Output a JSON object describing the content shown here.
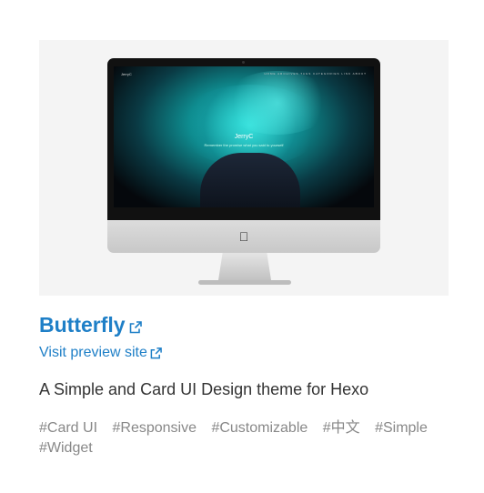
{
  "card": {
    "title": "Butterfly",
    "preview_link": "Visit preview site",
    "description": "A Simple and Card UI Design theme for Hexo",
    "tags": [
      "#Card UI",
      "#Responsive",
      "#Customizable",
      "#中文",
      "#Simple",
      "#Widget"
    ],
    "screenshot": {
      "site_name": "JerryC",
      "site_subtitle": "Remember the promise what you said to yourself",
      "brand": "JerryC",
      "nav": "HOME ARCHIVES TAGS CATEGORIES LINK ABOUT"
    }
  },
  "colors": {
    "link": "#1e7fc7",
    "tag": "#888888",
    "text": "#333333",
    "preview_bg": "#f4f4f4"
  },
  "icons": {
    "external_link": "external-link-icon",
    "apple_logo": "apple-logo-icon"
  }
}
